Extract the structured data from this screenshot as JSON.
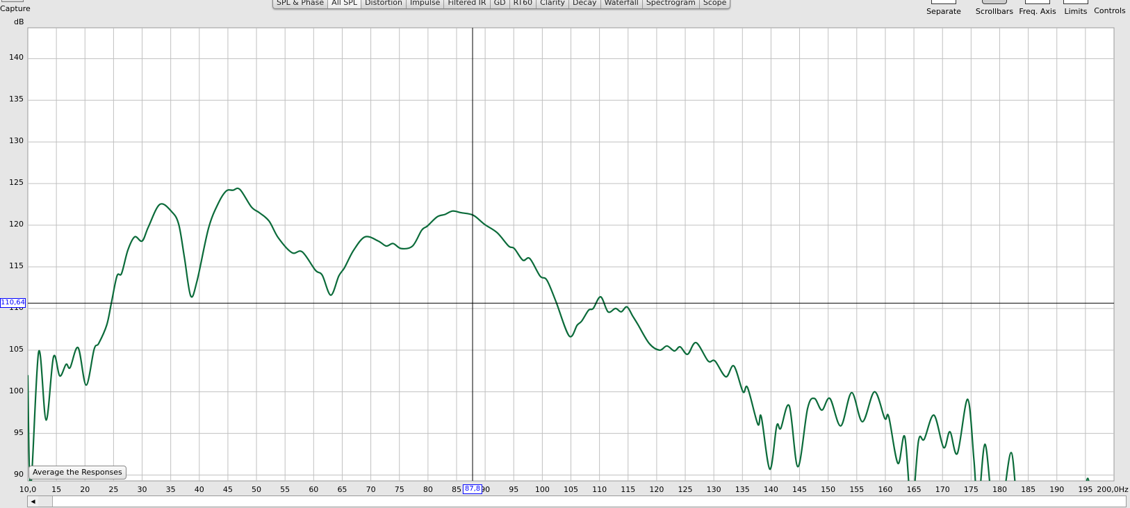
{
  "toolbar": {
    "capture_label": "Capture",
    "tabs": [
      "SPL & Phase",
      "All SPL",
      "Distortion",
      "Impulse",
      "Filtered IR",
      "GD",
      "RT60",
      "Clarity",
      "Decay",
      "Waterfall",
      "Spectrogram",
      "Scope"
    ],
    "active_tab": "All SPL",
    "tools": [
      "Separate",
      "Scrollbars",
      "Freq. Axis",
      "Limits",
      "Controls"
    ]
  },
  "plot": {
    "avg_button": "Average the Responses",
    "cursor_freq": "87,8",
    "cursor_level": "110,64"
  },
  "colors": {
    "trace": "#0b6b3a",
    "grid": "#c0c0c0",
    "cursor": "#000000",
    "cursor_label": "#0000ff"
  },
  "chart_data": {
    "type": "line",
    "title": "",
    "xlabel": "Hz",
    "ylabel": "dB",
    "xlim": [
      10,
      200
    ],
    "ylim": [
      89.3,
      143.7
    ],
    "grid": true,
    "y_ticks": [
      90,
      95,
      100,
      105,
      110,
      115,
      120,
      125,
      130,
      135,
      140
    ],
    "y_tick_labels": [
      "90",
      "95",
      "100",
      "105",
      "110",
      "115",
      "120",
      "125",
      "130",
      "135",
      "140"
    ],
    "x_ticks": [
      10,
      15,
      20,
      25,
      30,
      35,
      40,
      45,
      50,
      55,
      60,
      65,
      70,
      75,
      80,
      85,
      90,
      95,
      100,
      105,
      110,
      115,
      120,
      125,
      130,
      135,
      140,
      145,
      150,
      155,
      160,
      165,
      170,
      175,
      180,
      185,
      190,
      195,
      200
    ],
    "x_tick_labels": [
      "10,0",
      "15",
      "20",
      "25",
      "30",
      "35",
      "40",
      "45",
      "50",
      "55",
      "60",
      "65",
      "70",
      "75",
      "80",
      "85",
      "90",
      "95",
      "100",
      "105",
      "110",
      "115",
      "120",
      "125",
      "130",
      "135",
      "140",
      "145",
      "150",
      "155",
      "160",
      "165",
      "170",
      "175",
      "180",
      "185",
      "190",
      "195",
      "200,0Hz"
    ],
    "series": [
      {
        "name": "Average",
        "points": [
          [
            10,
            102
          ],
          [
            10.5,
            88.5
          ],
          [
            11.9,
            104.8
          ],
          [
            13.2,
            96.6
          ],
          [
            14.5,
            104.2
          ],
          [
            15.6,
            101.9
          ],
          [
            16.7,
            103.3
          ],
          [
            17.4,
            102.9
          ],
          [
            18.8,
            105.3
          ],
          [
            20.2,
            100.8
          ],
          [
            21.6,
            105.1
          ],
          [
            22.4,
            105.8
          ],
          [
            23.8,
            108
          ],
          [
            24.6,
            110.6
          ],
          [
            25.6,
            113.9
          ],
          [
            26.4,
            114.2
          ],
          [
            27.5,
            117
          ],
          [
            28.7,
            118.6
          ],
          [
            30,
            118.1
          ],
          [
            31.1,
            119.8
          ],
          [
            33.1,
            122.5
          ],
          [
            35.2,
            121.6
          ],
          [
            36.4,
            120.1
          ],
          [
            37.4,
            116.1
          ],
          [
            38.5,
            111.5
          ],
          [
            39.6,
            113.3
          ],
          [
            41.6,
            119.6
          ],
          [
            43.3,
            122.6
          ],
          [
            44.7,
            124.1
          ],
          [
            45.9,
            124.2
          ],
          [
            47.1,
            124.3
          ],
          [
            49.1,
            122.2
          ],
          [
            50.5,
            121.5
          ],
          [
            52.2,
            120.5
          ],
          [
            53.8,
            118.5
          ],
          [
            56.2,
            116.7
          ],
          [
            58,
            116.8
          ],
          [
            60.3,
            114.6
          ],
          [
            61.5,
            114
          ],
          [
            63,
            111.6
          ],
          [
            64.4,
            113.9
          ],
          [
            65.4,
            114.9
          ],
          [
            67,
            117
          ],
          [
            69,
            118.6
          ],
          [
            71.3,
            118.1
          ],
          [
            72.7,
            117.5
          ],
          [
            73.9,
            117.8
          ],
          [
            75.3,
            117.2
          ],
          [
            77.3,
            117.5
          ],
          [
            78.9,
            119.4
          ],
          [
            79.9,
            119.9
          ],
          [
            81.6,
            121
          ],
          [
            83,
            121.3
          ],
          [
            84.3,
            121.7
          ],
          [
            85.8,
            121.5
          ],
          [
            87.9,
            121.2
          ],
          [
            89.9,
            120.1
          ],
          [
            92.1,
            119.1
          ],
          [
            94.1,
            117.5
          ],
          [
            95.1,
            117.2
          ],
          [
            96.6,
            115.8
          ],
          [
            97.8,
            116
          ],
          [
            99.6,
            113.9
          ],
          [
            100.8,
            113.4
          ],
          [
            102.4,
            110.8
          ],
          [
            104.7,
            106.7
          ],
          [
            106.1,
            108
          ],
          [
            106.9,
            108.5
          ],
          [
            108.1,
            109.8
          ],
          [
            108.9,
            110
          ],
          [
            110.2,
            111.4
          ],
          [
            111.5,
            109.6
          ],
          [
            112.8,
            110
          ],
          [
            113.8,
            109.6
          ],
          [
            114.8,
            110.2
          ],
          [
            115.8,
            109.1
          ],
          [
            116.7,
            108.1
          ],
          [
            118.7,
            105.8
          ],
          [
            120.5,
            105
          ],
          [
            121.8,
            105.5
          ],
          [
            123.1,
            104.9
          ],
          [
            124.1,
            105.4
          ],
          [
            125.4,
            104.5
          ],
          [
            126.9,
            105.9
          ],
          [
            129,
            103.7
          ],
          [
            130.2,
            103.7
          ],
          [
            132.1,
            101.8
          ],
          [
            133.5,
            103.1
          ],
          [
            135.1,
            100
          ],
          [
            135.9,
            100.5
          ],
          [
            137.7,
            96.1
          ],
          [
            138.3,
            97
          ],
          [
            139.8,
            90.7
          ],
          [
            141,
            95.9
          ],
          [
            141.7,
            95.6
          ],
          [
            143.2,
            98.3
          ],
          [
            144.7,
            91
          ],
          [
            146.4,
            98
          ],
          [
            147.6,
            99.2
          ],
          [
            148.9,
            97.8
          ],
          [
            150.3,
            99.2
          ],
          [
            152.2,
            95.9
          ],
          [
            154.1,
            99.9
          ],
          [
            156,
            96.4
          ],
          [
            158.1,
            100
          ],
          [
            159.9,
            96.8
          ],
          [
            160.6,
            97
          ],
          [
            162.2,
            91.4
          ],
          [
            163.4,
            94.6
          ],
          [
            164.6,
            86
          ],
          [
            165.8,
            94.1
          ],
          [
            166.8,
            94.3
          ],
          [
            168.5,
            97.2
          ],
          [
            170.2,
            93.3
          ],
          [
            171.3,
            95.2
          ],
          [
            172.6,
            92.6
          ],
          [
            174.4,
            99.1
          ],
          [
            175.5,
            91.8
          ],
          [
            176.2,
            86
          ],
          [
            177.4,
            93.7
          ],
          [
            178.6,
            87
          ],
          [
            179.6,
            85
          ],
          [
            180.6,
            87
          ],
          [
            182,
            92.7
          ],
          [
            183,
            87
          ],
          [
            184,
            84
          ],
          [
            190,
            84
          ],
          [
            194.2,
            86
          ],
          [
            195.4,
            89.6
          ],
          [
            196.3,
            86
          ],
          [
            200,
            84
          ]
        ]
      }
    ]
  }
}
